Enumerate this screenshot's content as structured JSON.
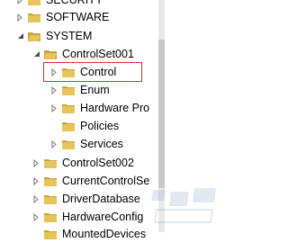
{
  "tree": {
    "rows": [
      {
        "label": "SECURITY",
        "expanded": false
      },
      {
        "label": "SOFTWARE",
        "expanded": false
      },
      {
        "label": "SYSTEM",
        "expanded": true
      },
      {
        "label": "ControlSet001",
        "expanded": true
      },
      {
        "label": "Control",
        "expanded": false,
        "highlighted": true
      },
      {
        "label": "Enum",
        "expanded": false
      },
      {
        "label": "Hardware Pro",
        "expanded": false
      },
      {
        "label": "Policies",
        "expanded": null
      },
      {
        "label": "Services",
        "expanded": false
      },
      {
        "label": "ControlSet002",
        "expanded": false
      },
      {
        "label": "CurrentControlSe",
        "expanded": false
      },
      {
        "label": "DriverDatabase",
        "expanded": false
      },
      {
        "label": "HardwareConfig",
        "expanded": false
      },
      {
        "label": "MountedDevices",
        "expanded": false
      }
    ]
  },
  "colors": {
    "folder": "#e7c45a",
    "folder_dark": "#c9a13b",
    "highlight_box": "#c23b3b",
    "scrollbar_track": "#e8e8e8",
    "scrollbar_thumb": "#c9c9c9"
  },
  "icons": {
    "expanded": "tree-expanded-icon",
    "collapsed": "tree-collapsed-icon",
    "folder": "folder-icon"
  }
}
